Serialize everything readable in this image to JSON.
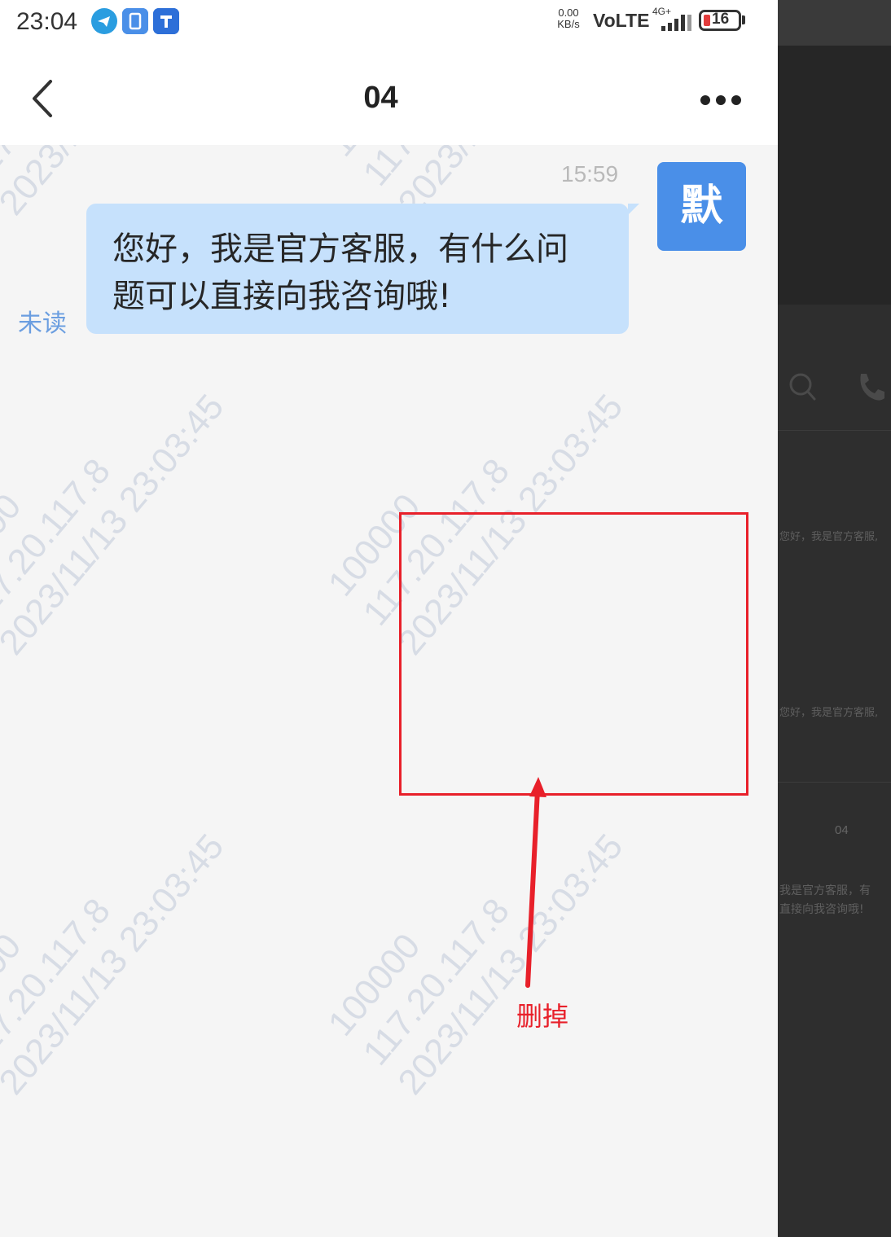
{
  "status_bar": {
    "time": "23:04",
    "net_speed_value": "0.00",
    "net_speed_unit": "KB/s",
    "volte": "VoLTE",
    "network": "4G+",
    "battery": "16",
    "app_icons": [
      "telegram-icon",
      "app-square-icon",
      "t-app-icon"
    ]
  },
  "nav": {
    "title": "04",
    "back_icon": "chevron-left-icon",
    "more_icon": "more-dots-icon"
  },
  "chat": {
    "time": "15:59",
    "avatar_char": "默",
    "message_line1": "您好，我是官方客服，有什么问",
    "message_line2": "题可以直接向我咨询哦!",
    "unread_label": "未读"
  },
  "watermark": {
    "line1": "100000",
    "line2": "117.20.117.8",
    "line3": "2023/11/13 23:03:45"
  },
  "annotation": {
    "label": "删掉",
    "color": "#e8202a"
  },
  "side_panel": {
    "snippet1": "您好，我是官方客服,",
    "snippet2": "您好，我是官方客服,",
    "title": "04",
    "msg_line1": "我是官方客服，有",
    "msg_line2": "直接向我咨询哦!"
  },
  "colors": {
    "bubble": "#c6e1fc",
    "avatar": "#4a8fe8",
    "unread": "#6b9ee0",
    "chat_bg": "#f5f5f5"
  }
}
